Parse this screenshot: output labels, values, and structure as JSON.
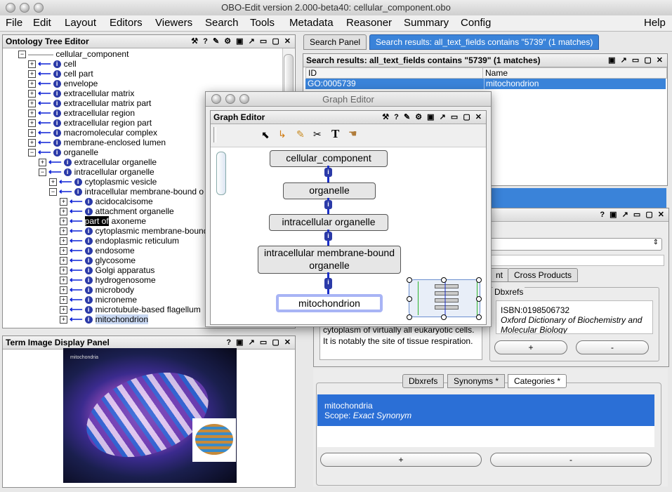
{
  "window": {
    "title": "OBO-Edit version 2.000-beta40: cellular_component.obo"
  },
  "menubar": {
    "items": [
      "File",
      "Edit",
      "Layout",
      "Editors",
      "Viewers",
      "Search",
      "Tools",
      "Metadata",
      "Reasoner",
      "Summary",
      "Config",
      "Help"
    ]
  },
  "tree_panel": {
    "title": "Ontology Tree Editor",
    "root": "cellular_component",
    "rows": [
      {
        "label": "cell"
      },
      {
        "label": "cell part"
      },
      {
        "label": "envelope"
      },
      {
        "label": "extracellular matrix"
      },
      {
        "label": "extracellular matrix part"
      },
      {
        "label": "extracellular region"
      },
      {
        "label": "extracellular region part"
      },
      {
        "label": "macromolecular complex"
      },
      {
        "label": "membrane-enclosed lumen"
      },
      {
        "label": "organelle"
      },
      {
        "label": "extracellular organelle"
      },
      {
        "label": "intracellular organelle"
      },
      {
        "label": "cytoplasmic vesicle"
      },
      {
        "label": "intracellular membrane-bound o"
      },
      {
        "label": "acidocalcisome"
      },
      {
        "label": "attachment organelle"
      },
      {
        "label": "axoneme",
        "prefix": "part of"
      },
      {
        "label": "cytoplasmic membrane-bound"
      },
      {
        "label": "endoplasmic reticulum"
      },
      {
        "label": "endosome"
      },
      {
        "label": "glycosome"
      },
      {
        "label": "Golgi apparatus"
      },
      {
        "label": "hydrogenosome"
      },
      {
        "label": "microbody"
      },
      {
        "label": "microneme"
      },
      {
        "label": "microtubule-based flagellum"
      },
      {
        "label": "mitochondrion"
      }
    ]
  },
  "image_panel": {
    "title": "Term Image Display Panel",
    "image_caption": "mitochondria"
  },
  "search": {
    "tabs": [
      "Search Panel",
      "Search results:  all_text_fields contains \"5739\" (1 matches)"
    ],
    "results_title": "Search results:  all_text_fields contains \"5739\" (1 matches)",
    "columns": [
      "ID",
      "Name"
    ],
    "rows": [
      {
        "id": "GO:0005739",
        "name": "mitochondrion"
      }
    ]
  },
  "graph_window": {
    "title": "Graph Editor",
    "panel_title": "Graph Editor",
    "nodes": [
      "cellular_component",
      "organelle",
      "intracellular organelle",
      "intracellular membrane-bound organelle",
      "mitochondrion"
    ]
  },
  "term_panel": {
    "tabs": [
      "nt",
      "Cross Products"
    ],
    "dbxrefs_label": "Dbxrefs",
    "definition": "cytoplasm of virtually all eukaryotic cells. It is notably the site of tissue respiration.",
    "dbxref_id": "ISBN:0198506732",
    "dbxref_desc": "Oxford Dictionary of Biochemistry and Molecular Biology",
    "plus": "+",
    "minus": "-"
  },
  "synonym_panel": {
    "tabs": [
      "Dbxrefs",
      "Synonyms *",
      "Categories *"
    ],
    "synonym": "mitochondria",
    "scope_label": "Scope: ",
    "scope_value": "Exact Synonym",
    "plus": "+",
    "minus": "-"
  },
  "colors": {
    "selection": "#3a83d9",
    "arrow": "#0a1fd6",
    "node_border_sel": "#a8b4f5"
  }
}
